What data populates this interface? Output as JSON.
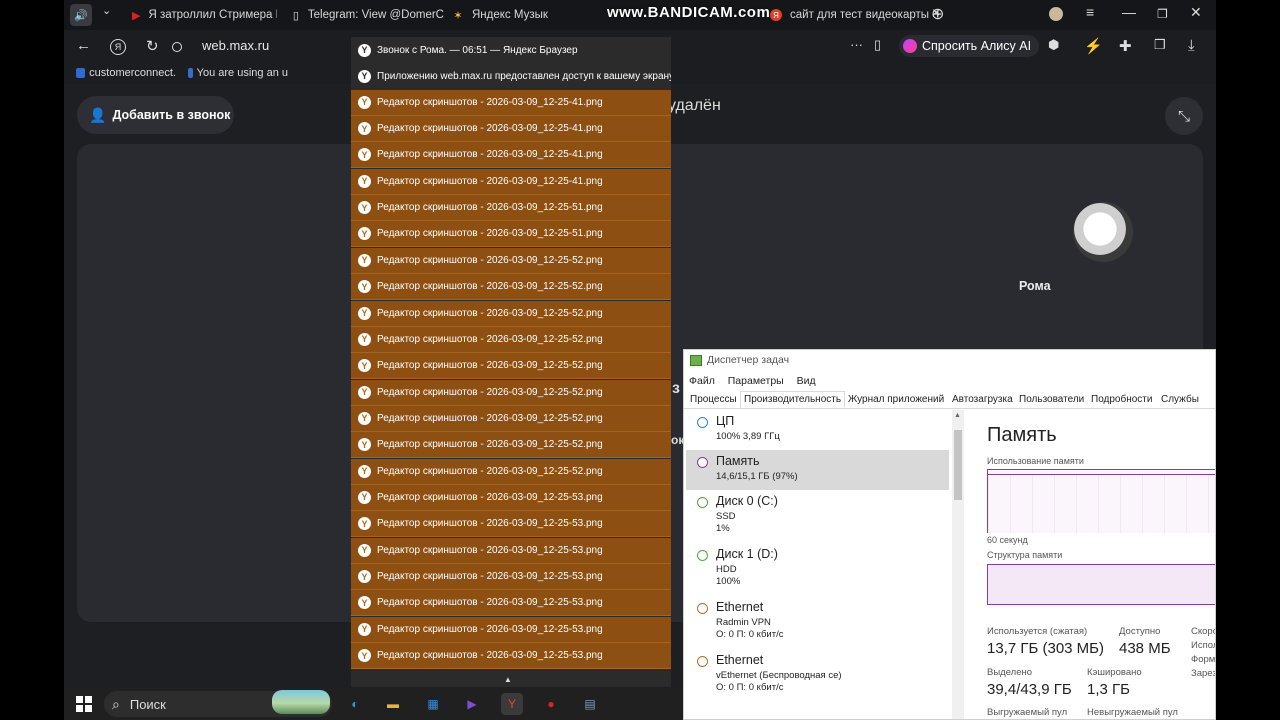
{
  "overlay": {
    "watermark": "www.BANDICAM.com"
  },
  "browser": {
    "tabs": [
      {
        "label": "Я затроллил Стримера М",
        "icon": "youtube-icon"
      },
      {
        "label": "Telegram: View @DomerC",
        "icon": "page-icon"
      },
      {
        "label": "Яндекс Музык",
        "icon": "music-icon"
      },
      {
        "label": "сайт для тест видеокарты",
        "icon": "yandex-icon"
      }
    ],
    "url": "web.max.ru",
    "alice_label": "Спросить Алису AI",
    "bookmarks": [
      {
        "label": "customerconnect."
      },
      {
        "label": "You are using an u"
      }
    ]
  },
  "page": {
    "add_call_label": "Добавить в звонок",
    "removed_text": "удалён",
    "participant_name": "Рома",
    "ghost_chars": [
      "з",
      "ок"
    ]
  },
  "notifications": [
    {
      "text": "Звонок с Рома. — 06:51 — Яндекс Браузер",
      "style": "dark"
    },
    {
      "text": "Приложению web.max.ru предоставлен доступ к вашему экрану.",
      "style": "dark"
    },
    {
      "text": "Редактор скриншотов - 2026-03-09_12-25-41.png",
      "style": "org"
    },
    {
      "text": "Редактор скриншотов - 2026-03-09_12-25-41.png",
      "style": "org"
    },
    {
      "text": "Редактор скриншотов - 2026-03-09_12-25-41.png",
      "style": "org"
    },
    {
      "text": "Редактор скриншотов - 2026-03-09_12-25-41.png",
      "style": "org"
    },
    {
      "text": "Редактор скриншотов - 2026-03-09_12-25-51.png",
      "style": "org"
    },
    {
      "text": "Редактор скриншотов - 2026-03-09_12-25-51.png",
      "style": "org"
    },
    {
      "text": "Редактор скриншотов - 2026-03-09_12-25-52.png",
      "style": "org"
    },
    {
      "text": "Редактор скриншотов - 2026-03-09_12-25-52.png",
      "style": "org"
    },
    {
      "text": "Редактор скриншотов - 2026-03-09_12-25-52.png",
      "style": "org"
    },
    {
      "text": "Редактор скриншотов - 2026-03-09_12-25-52.png",
      "style": "org"
    },
    {
      "text": "Редактор скриншотов - 2026-03-09_12-25-52.png",
      "style": "org"
    },
    {
      "text": "Редактор скриншотов - 2026-03-09_12-25-52.png",
      "style": "org"
    },
    {
      "text": "Редактор скриншотов - 2026-03-09_12-25-52.png",
      "style": "org"
    },
    {
      "text": "Редактор скриншотов - 2026-03-09_12-25-52.png",
      "style": "org"
    },
    {
      "text": "Редактор скриншотов - 2026-03-09_12-25-52.png",
      "style": "org"
    },
    {
      "text": "Редактор скриншотов - 2026-03-09_12-25-53.png",
      "style": "org"
    },
    {
      "text": "Редактор скриншотов - 2026-03-09_12-25-53.png",
      "style": "org"
    },
    {
      "text": "Редактор скриншотов - 2026-03-09_12-25-53.png",
      "style": "org"
    },
    {
      "text": "Редактор скриншотов - 2026-03-09_12-25-53.png",
      "style": "org"
    },
    {
      "text": "Редактор скриншотов - 2026-03-09_12-25-53.png",
      "style": "org"
    },
    {
      "text": "Редактор скриншотов - 2026-03-09_12-25-53.png",
      "style": "org"
    },
    {
      "text": "Редактор скриншотов - 2026-03-09_12-25-53.png",
      "style": "org"
    }
  ],
  "taskbar": {
    "search_label": "Поиск",
    "apps": [
      {
        "name": "edge-icon",
        "glyph": "◐",
        "color": "#2aa0d8"
      },
      {
        "name": "explorer-icon",
        "glyph": "▬",
        "color": "#e8b53a"
      },
      {
        "name": "store-icon",
        "glyph": "▦",
        "color": "#3b8fe0"
      },
      {
        "name": "media-icon",
        "glyph": "▶",
        "color": "#7a4fd0"
      },
      {
        "name": "yandex-browser-icon",
        "glyph": "Y",
        "color": "#e04a2a",
        "active": true
      },
      {
        "name": "bandicam-record-icon",
        "glyph": "●",
        "color": "#e0202a"
      },
      {
        "name": "task-manager-icon",
        "glyph": "▤",
        "color": "#7fa0c8"
      }
    ]
  },
  "task_manager": {
    "title": "Диспетчер задач",
    "menu": [
      "Файл",
      "Параметры",
      "Вид"
    ],
    "tabs": [
      "Процессы",
      "Производительность",
      "Журнал приложений",
      "Автозагрузка",
      "Пользователи",
      "Подробности",
      "Службы"
    ],
    "selected_tab": "Производительность",
    "resources": [
      {
        "name": "ЦП",
        "sub1": "100% 3,89 ГГц",
        "sub2": "",
        "color": "#2a8ac0"
      },
      {
        "name": "Память",
        "sub1": "14,6/15,1 ГБ (97%)",
        "sub2": "",
        "color": "#8b3aa0",
        "selected": true
      },
      {
        "name": "Диск 0 (C:)",
        "sub1": "SSD",
        "sub2": "1%",
        "color": "#4caa3c"
      },
      {
        "name": "Диск 1 (D:)",
        "sub1": "HDD",
        "sub2": "100%",
        "color": "#4caa3c"
      },
      {
        "name": "Ethernet",
        "sub1": "Radmin VPN",
        "sub2": "О: 0 П: 0 кбит/с",
        "color": "#b0702a"
      },
      {
        "name": "Ethernet",
        "sub1": "vEthernet (Беспроводная се)",
        "sub2": "О: 0 П: 0 кбит/с",
        "color": "#b0702a"
      }
    ],
    "memory": {
      "title": "Память",
      "usage_label": "Использование памяти",
      "time_label": "60 секунд",
      "structure_label": "Структура памяти",
      "in_use_label": "Используется (сжатая)",
      "in_use_value": "13,7 ГБ (303 МБ)",
      "available_label": "Доступно",
      "available_value": "438 МБ",
      "speed_label": "Скоро",
      "extra_labels": [
        "Испол",
        "Форм",
        "Зарез"
      ],
      "committed_label": "Выделено",
      "committed_value": "39,4/43,9 ГБ",
      "cached_label": "Кэшировано",
      "cached_value": "1,3 ГБ",
      "paged_label": "Выгружаемый пул",
      "nonpaged_label": "Невыгружаемый пул"
    }
  }
}
